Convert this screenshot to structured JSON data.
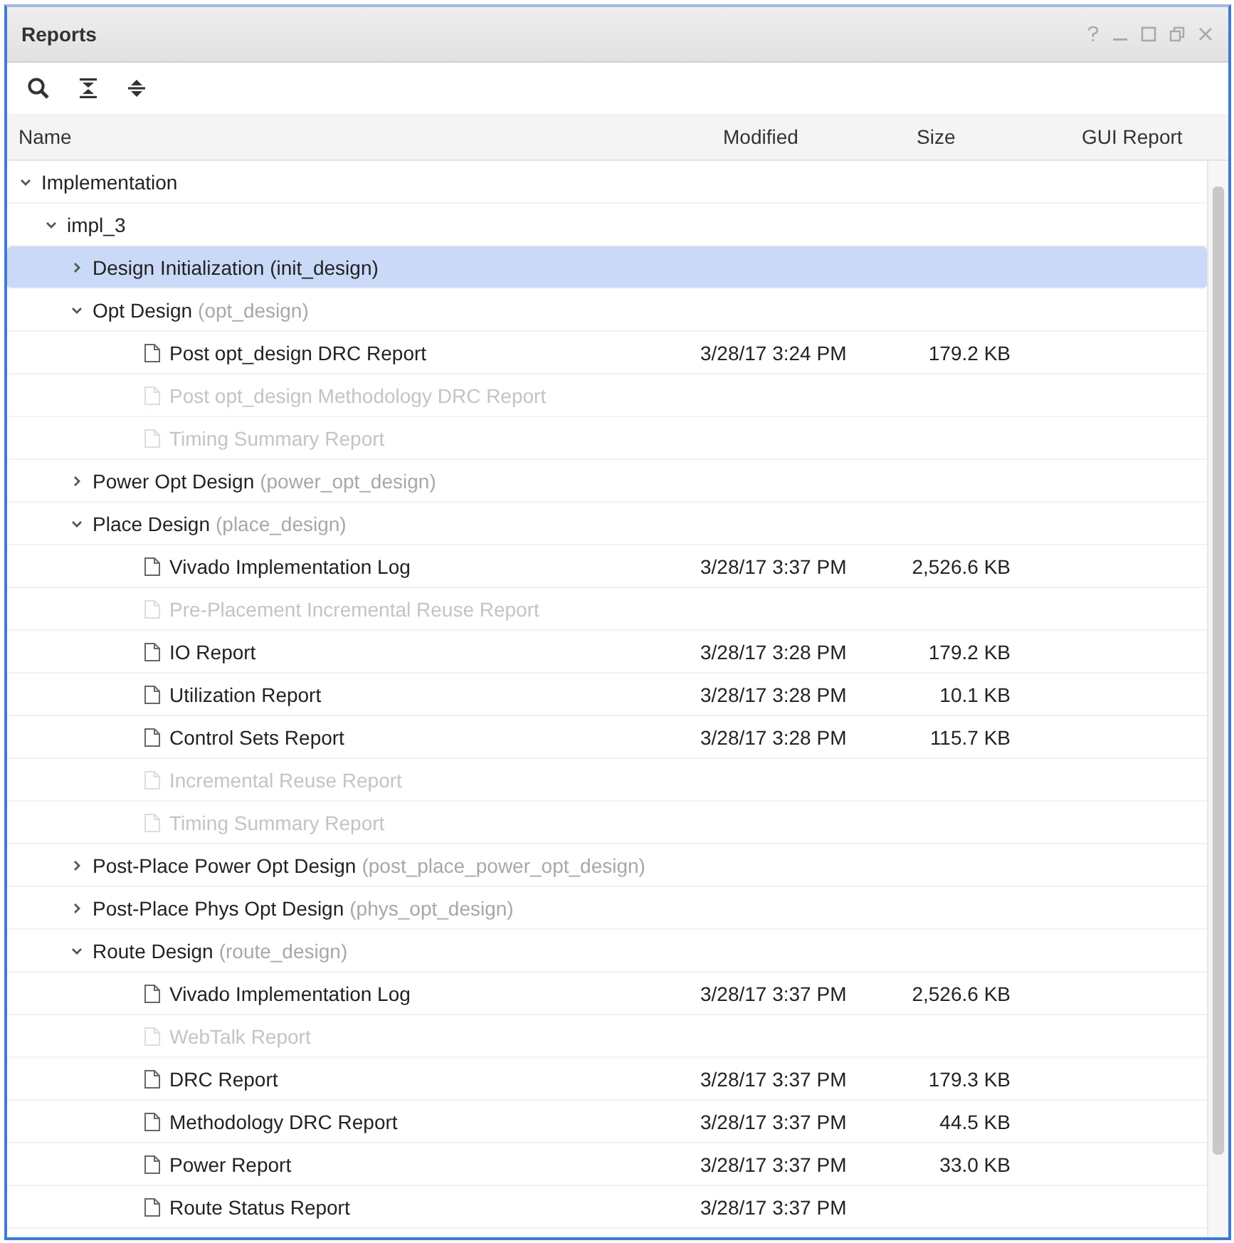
{
  "window": {
    "title": "Reports"
  },
  "table": {
    "columns": [
      "Name",
      "Modified",
      "Size",
      "GUI Report"
    ],
    "tree": [
      {
        "kind": "group",
        "name": "Implementation",
        "expanded": true,
        "children": [
          {
            "kind": "group",
            "name": "impl_3",
            "expanded": true,
            "children": [
              {
                "kind": "step",
                "name": "Design Initialization",
                "task": "(init_design)",
                "expanded": false,
                "selected": true
              },
              {
                "kind": "step",
                "name": "Opt Design",
                "task": "(opt_design)",
                "expanded": true,
                "selected": false,
                "children": [
                  {
                    "kind": "report",
                    "name": "Post opt_design DRC Report",
                    "modified": "3/28/17 3:24 PM",
                    "size": "179.2 KB",
                    "disabled": false
                  },
                  {
                    "kind": "report",
                    "name": "Post opt_design Methodology DRC Report",
                    "disabled": true
                  },
                  {
                    "kind": "report",
                    "name": "Timing Summary Report",
                    "disabled": true
                  }
                ]
              },
              {
                "kind": "step",
                "name": "Power Opt Design",
                "task": "(power_opt_design)",
                "expanded": false,
                "selected": false
              },
              {
                "kind": "step",
                "name": "Place Design",
                "task": "(place_design)",
                "expanded": true,
                "selected": false,
                "children": [
                  {
                    "kind": "report",
                    "name": "Vivado Implementation Log",
                    "modified": "3/28/17 3:37 PM",
                    "size": "2,526.6 KB",
                    "disabled": false
                  },
                  {
                    "kind": "report",
                    "name": "Pre-Placement Incremental Reuse Report",
                    "disabled": true
                  },
                  {
                    "kind": "report",
                    "name": "IO Report",
                    "modified": "3/28/17 3:28 PM",
                    "size": "179.2 KB",
                    "disabled": false
                  },
                  {
                    "kind": "report",
                    "name": "Utilization Report",
                    "modified": "3/28/17 3:28 PM",
                    "size": "10.1 KB",
                    "disabled": false
                  },
                  {
                    "kind": "report",
                    "name": "Control Sets Report",
                    "modified": "3/28/17 3:28 PM",
                    "size": "115.7 KB",
                    "disabled": false
                  },
                  {
                    "kind": "report",
                    "name": "Incremental Reuse Report",
                    "disabled": true
                  },
                  {
                    "kind": "report",
                    "name": "Timing Summary Report",
                    "disabled": true
                  }
                ]
              },
              {
                "kind": "step",
                "name": "Post-Place Power Opt Design",
                "task": "(post_place_power_opt_design)",
                "expanded": false,
                "selected": false
              },
              {
                "kind": "step",
                "name": "Post-Place Phys Opt Design",
                "task": "(phys_opt_design)",
                "expanded": false,
                "selected": false
              },
              {
                "kind": "step",
                "name": "Route Design",
                "task": "(route_design)",
                "expanded": true,
                "selected": false,
                "children": [
                  {
                    "kind": "report",
                    "name": "Vivado Implementation Log",
                    "modified": "3/28/17 3:37 PM",
                    "size": "2,526.6 KB",
                    "disabled": false
                  },
                  {
                    "kind": "report",
                    "name": "WebTalk Report",
                    "disabled": true
                  },
                  {
                    "kind": "report",
                    "name": "DRC Report",
                    "modified": "3/28/17 3:37 PM",
                    "size": "179.3 KB",
                    "disabled": false
                  },
                  {
                    "kind": "report",
                    "name": "Methodology DRC Report",
                    "modified": "3/28/17 3:37 PM",
                    "size": "44.5 KB",
                    "disabled": false
                  },
                  {
                    "kind": "report",
                    "name": "Power Report",
                    "modified": "3/28/17 3:37 PM",
                    "size": "33.0 KB",
                    "disabled": false
                  },
                  {
                    "kind": "report",
                    "name": "Route Status Report",
                    "modified": "3/28/17 3:37 PM",
                    "disabled": false
                  }
                ]
              }
            ]
          }
        ]
      }
    ]
  }
}
